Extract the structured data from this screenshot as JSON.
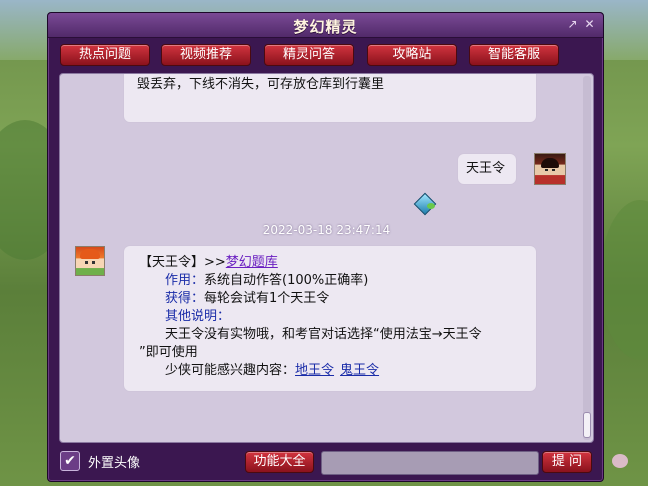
{
  "window": {
    "title": "梦幻精灵"
  },
  "titlebar": {
    "restore_glyph": "↗",
    "close_glyph": "✕"
  },
  "tabs": [
    {
      "label": "热点问题"
    },
    {
      "label": "视频推荐"
    },
    {
      "label": "精灵问答"
    },
    {
      "label": "攻略站"
    },
    {
      "label": "智能客服"
    }
  ],
  "chat": {
    "prev_message_tail": "毁丢弃，下线不消失，可存放仓库到行囊里",
    "user_query": "天王令",
    "timestamp": "2022-03-18 23:47:14",
    "answer": {
      "head_prefix": "【天王令】>>",
      "head_link": "梦幻题库",
      "rows": [
        {
          "key": "作用",
          "value": "系统自动作答(100%正确率)"
        },
        {
          "key": "获得",
          "value": "每轮会试有1个天王令"
        }
      ],
      "other_title": "其他说明：",
      "other_text_1": "天王令没有实物哦，和考官对话选择“使用法宝→天王令",
      "other_text_2": "”即可使用",
      "interest_label": "少侠可能感兴趣内容：",
      "interest_links": [
        "地王令",
        "鬼王令"
      ]
    }
  },
  "bottom": {
    "checkbox_checked": true,
    "checkbox_label": "外置头像",
    "feature_button": "功能大全",
    "input_value": "",
    "ask_button": "提 问"
  },
  "colors": {
    "accent": "#b0202a",
    "frame": "#3b1750",
    "chat_bg": "#d2c8dd",
    "link": "#1a2ca8"
  },
  "icons": [
    "restore-icon",
    "close-icon",
    "npc-avatar-icon",
    "user-avatar-icon",
    "cursor-icon",
    "check-icon"
  ]
}
